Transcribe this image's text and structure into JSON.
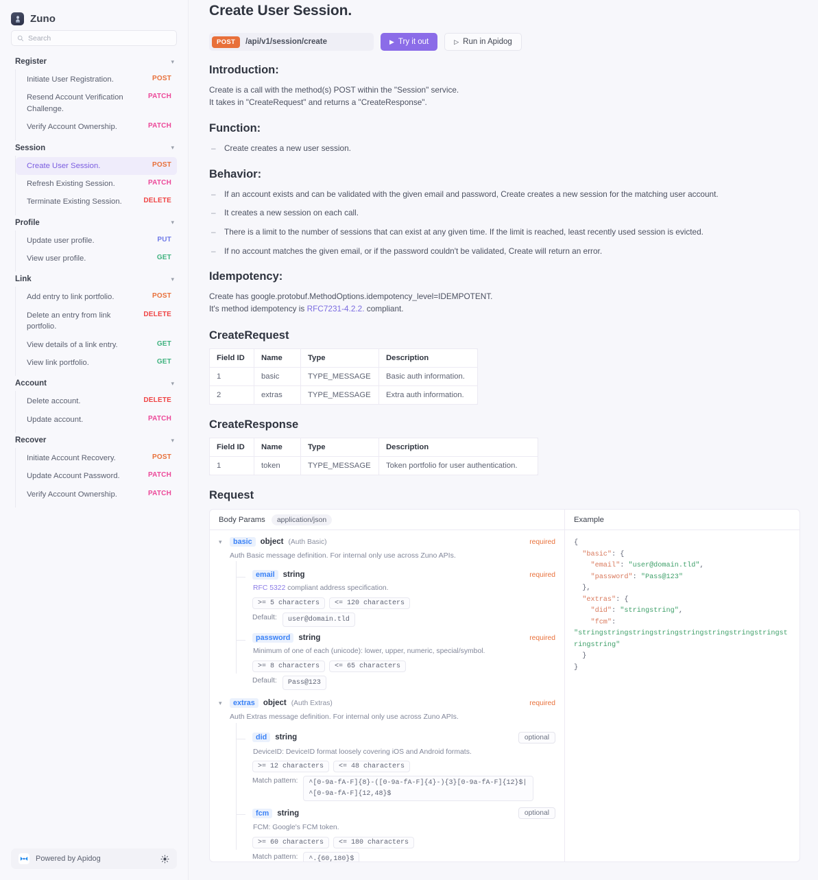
{
  "sidebar": {
    "brand": {
      "name": "Zuno",
      "logo_icon": "statue-logo-icon"
    },
    "search": {
      "placeholder": "Search",
      "value": "",
      "icon": "search-icon"
    },
    "groups": [
      {
        "title": "Register",
        "items": [
          {
            "label": "Initiate User Registration.",
            "method": "POST"
          },
          {
            "label": "Resend Account Verification Challenge.",
            "method": "PATCH"
          },
          {
            "label": "Verify Account Ownership.",
            "method": "PATCH"
          }
        ]
      },
      {
        "title": "Session",
        "items": [
          {
            "label": "Create User Session.",
            "method": "POST",
            "active": true
          },
          {
            "label": "Refresh Existing Session.",
            "method": "PATCH"
          },
          {
            "label": "Terminate Existing Session.",
            "method": "DELETE"
          }
        ]
      },
      {
        "title": "Profile",
        "items": [
          {
            "label": "Update user profile.",
            "method": "PUT"
          },
          {
            "label": "View user profile.",
            "method": "GET"
          }
        ]
      },
      {
        "title": "Link",
        "items": [
          {
            "label": "Add entry to link portfolio.",
            "method": "POST"
          },
          {
            "label": "Delete an entry from link portfolio.",
            "method": "DELETE"
          },
          {
            "label": "View details of a link entry.",
            "method": "GET"
          },
          {
            "label": "View link portfolio.",
            "method": "GET"
          }
        ]
      },
      {
        "title": "Account",
        "items": [
          {
            "label": "Delete account.",
            "method": "DELETE"
          },
          {
            "label": "Update account.",
            "method": "PATCH"
          }
        ]
      },
      {
        "title": "Recover",
        "items": [
          {
            "label": "Initiate Account Recovery.",
            "method": "POST"
          },
          {
            "label": "Update Account Password.",
            "method": "PATCH"
          },
          {
            "label": "Verify Account Ownership.",
            "method": "PATCH"
          }
        ]
      }
    ],
    "footer": {
      "text": "Powered by Apidog",
      "brand_icon": "apidog-icon",
      "theme_icon": "sun-icon"
    }
  },
  "header": {
    "title": "Create User Session.",
    "method": "POST",
    "path": "/api/v1/session/create",
    "try_it_out": "Try it out",
    "run_in_apidog": "Run in Apidog"
  },
  "introduction": {
    "heading": "Introduction:",
    "line1": "Create is a call with the method(s) POST within the \"Session\" service.",
    "line2": "It takes in \"CreateRequest\" and returns a \"CreateResponse\"."
  },
  "function": {
    "heading": "Function:",
    "items": [
      "Create creates a new user session."
    ]
  },
  "behavior": {
    "heading": "Behavior:",
    "items": [
      "If an account exists and can be validated with the given email and password, Create creates a new session for the matching user account.",
      "It creates a new session on each call.",
      "There is a limit to the number of sessions that can exist at any given time. If the limit is reached, least recently used session is evicted.",
      "If no account matches the given email, or if the password couldn't be validated, Create will return an error."
    ]
  },
  "idempotency": {
    "heading": "Idempotency:",
    "line1": "Create has google.protobuf.MethodOptions.idempotency_level=IDEMPOTENT.",
    "line2_pre": "It's method idempotency is ",
    "line2_link": "RFC7231-4.2.2.",
    "line2_post": " compliant."
  },
  "create_request": {
    "title": "CreateRequest",
    "columns": [
      "Field ID",
      "Name",
      "Type",
      "Description"
    ],
    "rows": [
      [
        "1",
        "basic",
        "TYPE_MESSAGE",
        "Basic auth information."
      ],
      [
        "2",
        "extras",
        "TYPE_MESSAGE",
        "Extra auth information."
      ]
    ]
  },
  "create_response": {
    "title": "CreateResponse",
    "columns": [
      "Field ID",
      "Name",
      "Type",
      "Description"
    ],
    "rows": [
      [
        "1",
        "token",
        "TYPE_MESSAGE",
        "Token portfolio for user authentication."
      ]
    ]
  },
  "request": {
    "title": "Request",
    "body_params_label": "Body Params",
    "content_type": "application/json",
    "example_label": "Example",
    "params": [
      {
        "name": "basic",
        "type": "object",
        "note": "(Auth Basic)",
        "requirement": "required",
        "description": "Auth Basic message definition. For internal only use across Zuno APIs.",
        "children": [
          {
            "name": "email",
            "type": "string",
            "requirement": "required",
            "desc_link": "RFC 5322",
            "desc_rest": " compliant address specification.",
            "min": ">= 5 characters",
            "max": "<= 120 characters",
            "default_label": "Default:",
            "default_value": "user@domain.tld"
          },
          {
            "name": "password",
            "type": "string",
            "requirement": "required",
            "desc_rest": "Minimum of one of each (unicode): lower, upper, numeric, special/symbol.",
            "min": ">= 8 characters",
            "max": "<= 65 characters",
            "default_label": "Default:",
            "default_value": "Pass@123"
          }
        ]
      },
      {
        "name": "extras",
        "type": "object",
        "note": "(Auth Extras)",
        "requirement": "required",
        "description": "Auth Extras message definition. For internal only use across Zuno APIs.",
        "children": [
          {
            "name": "did",
            "type": "string",
            "requirement": "optional",
            "desc_rest": "DeviceID: DeviceID format loosely covering iOS and Android formats.",
            "min": ">= 12 characters",
            "max": "<= 48 characters",
            "pattern_label": "Match pattern:",
            "pattern_value": "^[0-9a-fA-F]{8}-([0-9a-fA-F]{4}-){3}[0-9a-fA-F]{12}$|^[0-9a-fA-F]{12,48}$"
          },
          {
            "name": "fcm",
            "type": "string",
            "requirement": "optional",
            "desc_rest": "FCM: Google's FCM token.",
            "min": ">= 60 characters",
            "max": "<= 180 characters",
            "pattern_label": "Match pattern:",
            "pattern_value": "^.{60,180}$"
          }
        ]
      }
    ],
    "example_json": {
      "l1": "{",
      "l2_key": "\"basic\"",
      "l2_pun": ": {",
      "l3_key": "\"email\"",
      "l3_pun": ": ",
      "l3_val": "\"user@domain.tld\"",
      "l3_end": ",",
      "l4_key": "\"password\"",
      "l4_pun": ": ",
      "l4_val": "\"Pass@123\"",
      "l5": "},",
      "l6_key": "\"extras\"",
      "l6_pun": ": {",
      "l7_key": "\"did\"",
      "l7_pun": ": ",
      "l7_val": "\"stringstring\"",
      "l7_end": ",",
      "l8_key": "\"fcm\"",
      "l8_pun": ":",
      "l9_val": "\"stringstringstringstringstringstringstringstringstringstring\"",
      "l10": "}",
      "l11": "}"
    }
  },
  "colors": {
    "accent": "#8b6ce8",
    "post": "#e8703a",
    "patch": "#ec4899",
    "delete": "#ef4444",
    "get": "#3fb27f",
    "put": "#6f7ae8",
    "background": "#f7f7fb"
  }
}
